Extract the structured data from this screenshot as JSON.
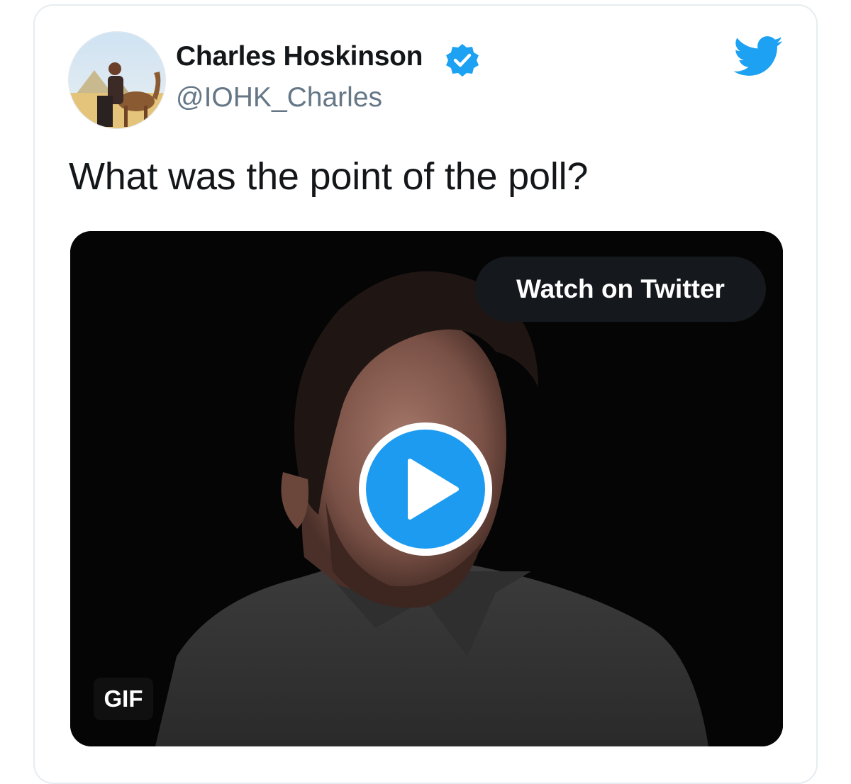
{
  "tweet": {
    "author_name": "Charles Hoskinson",
    "author_handle": "@IOHK_Charles",
    "text": "What was the point of the poll?",
    "verified": true
  },
  "media": {
    "watch_label": "Watch on Twitter",
    "gif_label": "GIF",
    "type": "animated-gif-preview"
  },
  "icons": {
    "verified": "verified-badge-icon",
    "brand": "twitter-bird-icon",
    "play": "play-icon"
  },
  "colors": {
    "accent": "#1da1f2",
    "text_primary": "#14171a",
    "text_secondary": "#657786",
    "border": "#e6ecf0"
  }
}
